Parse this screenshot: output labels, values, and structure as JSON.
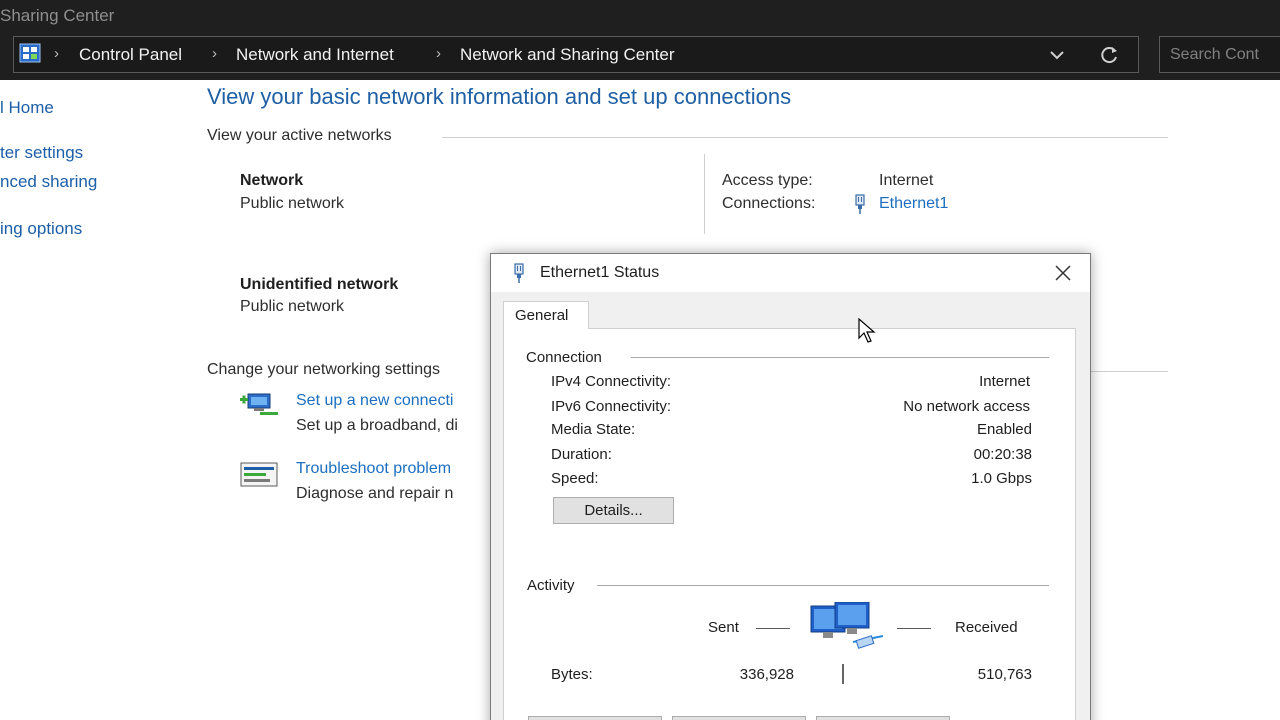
{
  "window": {
    "title": "Sharing Center"
  },
  "address_bar": {
    "crumbs": [
      "Control Panel",
      "Network and Internet",
      "Network and Sharing Center"
    ],
    "search_placeholder": "Search Cont"
  },
  "left_nav": {
    "items": [
      "l Home",
      "ter settings",
      "nced sharing",
      "ing options"
    ]
  },
  "main": {
    "title": "View your basic network information and set up connections",
    "active_networks_heading": "View your active networks",
    "networks": [
      {
        "name": "Network",
        "type": "Public network"
      },
      {
        "name": "Unidentified network",
        "type": "Public network"
      }
    ],
    "access": {
      "access_type_label": "Access type:",
      "access_type_value": "Internet",
      "connections_label": "Connections:",
      "connections_value": "Ethernet1"
    },
    "change_settings_heading": "Change your networking settings",
    "tasks": [
      {
        "link": "Set up a new connecti",
        "desc": "Set up a broadband, di"
      },
      {
        "link": "Troubleshoot problem",
        "desc": "Diagnose and repair n"
      }
    ]
  },
  "dialog": {
    "title": "Ethernet1 Status",
    "tab": "General",
    "connection": {
      "heading": "Connection",
      "rows": [
        {
          "label": "IPv4 Connectivity:",
          "value": "Internet"
        },
        {
          "label": "IPv6 Connectivity:",
          "value": "No network access"
        },
        {
          "label": "Media State:",
          "value": "Enabled"
        },
        {
          "label": "Duration:",
          "value": "00:20:38"
        },
        {
          "label": "Speed:",
          "value": "1.0 Gbps"
        }
      ],
      "details_button": "Details..."
    },
    "activity": {
      "heading": "Activity",
      "sent_label": "Sent",
      "received_label": "Received",
      "bytes_label": "Bytes:",
      "bytes_sent": "336,928",
      "bytes_received": "510,763"
    }
  },
  "colors": {
    "title_blue": "#1f5fa4",
    "link_blue": "#1c6fc0",
    "chrome_dark": "#1f1f1f"
  }
}
